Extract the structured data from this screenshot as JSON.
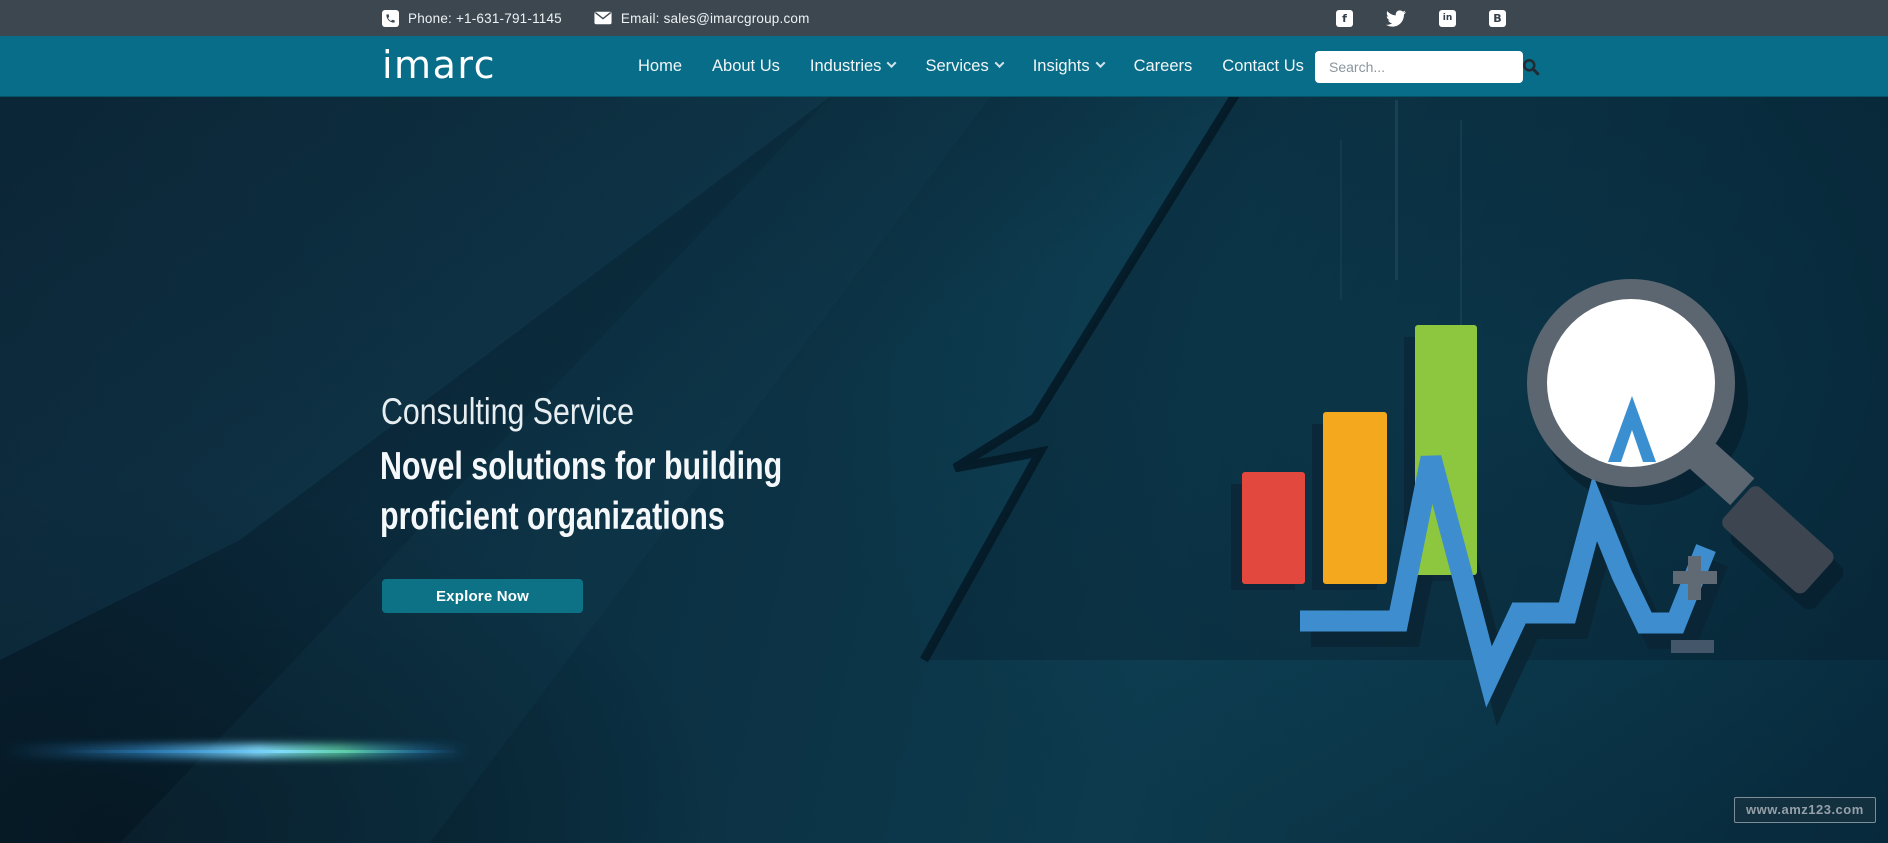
{
  "topbar": {
    "phone": "Phone: +1-631-791-1145",
    "email": "Email: sales@imarcgroup.com",
    "facebook_glyph": "f",
    "linkedin_glyph": "in",
    "blogger_glyph": "B"
  },
  "navbar": {
    "logo_text": "imarc",
    "items": [
      {
        "label": "Home",
        "has_dropdown": false
      },
      {
        "label": "About Us",
        "has_dropdown": false
      },
      {
        "label": "Industries",
        "has_dropdown": true
      },
      {
        "label": "Services",
        "has_dropdown": true
      },
      {
        "label": "Insights",
        "has_dropdown": true
      },
      {
        "label": "Careers",
        "has_dropdown": false
      },
      {
        "label": "Contact Us",
        "has_dropdown": false
      }
    ],
    "search_placeholder": "Search..."
  },
  "hero": {
    "eyebrow": "Consulting Service",
    "heading_line1": "Novel solutions for building",
    "heading_line2": "proficient organizations",
    "cta_label": "Explore Now"
  },
  "watermark_text": "www.amz123.com",
  "colors": {
    "topbar_bg": "#3c4750",
    "nav_bg": "#076d88",
    "cta_bg": "#0d7285",
    "bar_red": "#e2483d",
    "bar_orange": "#f4a81d",
    "bar_green": "#8dc63f",
    "trend_blue": "#3e8ecf",
    "magnifier_gray": "#5b6670",
    "handle_dark": "#3d4650",
    "lens_white": "#ffffff",
    "shadow_navy": "#0a2434",
    "plus_gray": "#5f6a74",
    "minus_gray": "#44566a"
  }
}
